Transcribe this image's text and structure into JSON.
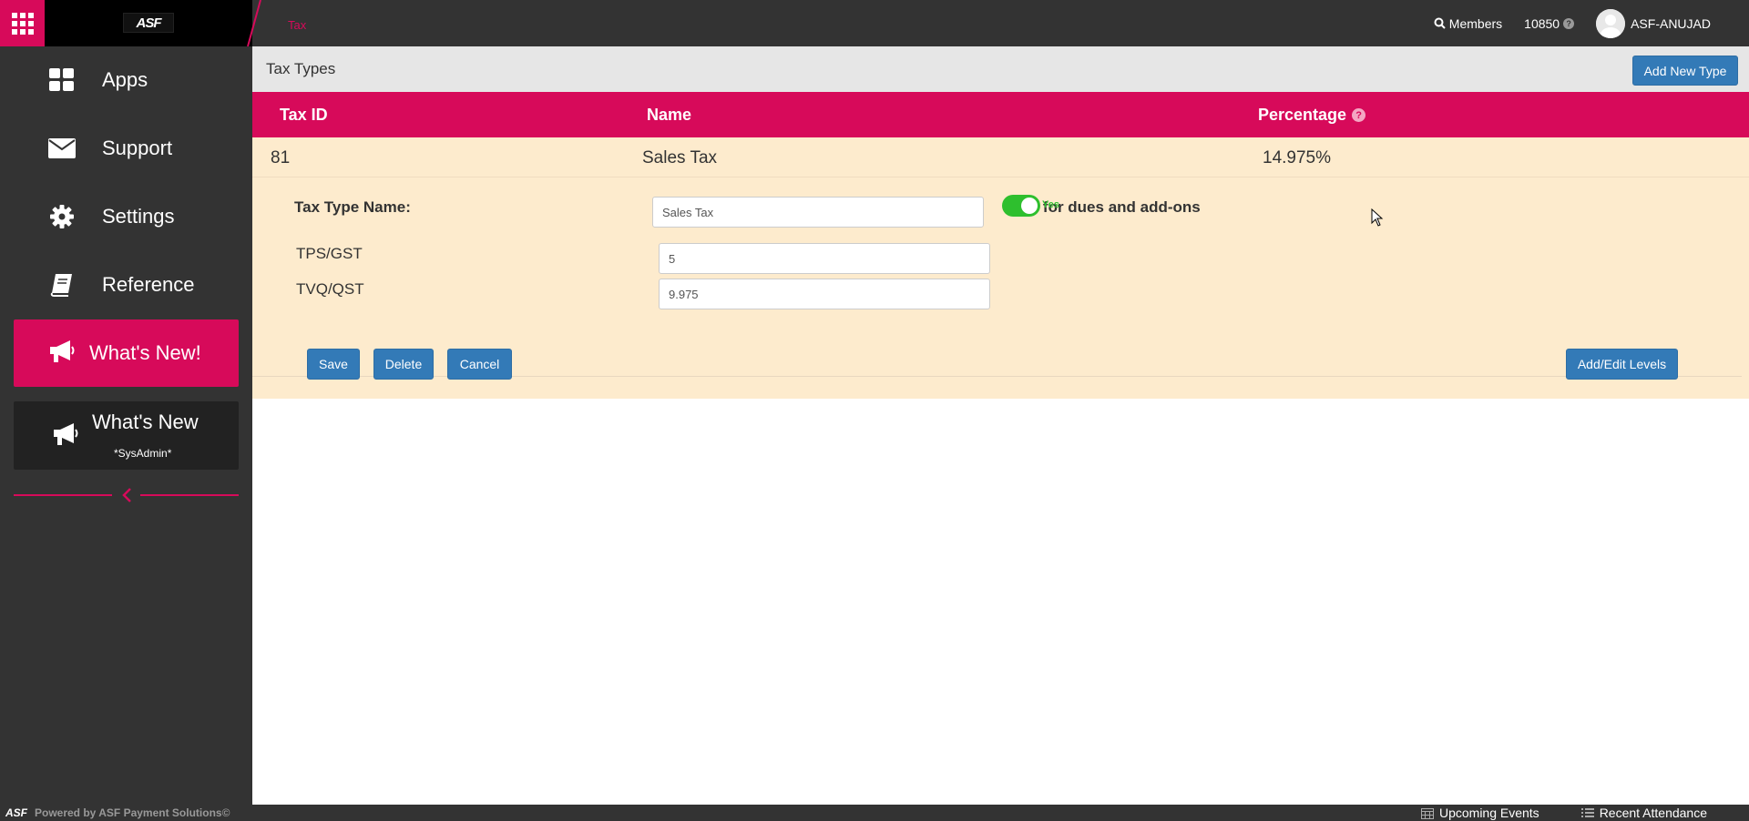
{
  "topbar": {
    "logo_text": "ASF",
    "breadcrumb": "Tax",
    "members_label": "Members",
    "credits": "10850",
    "help_glyph": "?",
    "username": "ASF-ANUJAD"
  },
  "sidebar": {
    "items": [
      {
        "label": "Apps",
        "icon": "apps-grid-icon"
      },
      {
        "label": "Support",
        "icon": "envelope-icon"
      },
      {
        "label": "Settings",
        "icon": "gear-icon"
      },
      {
        "label": "Reference",
        "icon": "book-icon"
      }
    ],
    "whats_new_highlight": "What's New!",
    "whats_new_sys": {
      "label": "What's New",
      "sub": "*SysAdmin*"
    },
    "accent_color": "#d70a5a"
  },
  "main": {
    "title": "Tax Types",
    "add_button": "Add New Type",
    "table": {
      "headers": [
        "Tax ID",
        "Name",
        "Percentage"
      ],
      "help_glyph": "?",
      "row": {
        "tax_id": "81",
        "name": "Sales Tax",
        "percentage": "14.975%"
      }
    },
    "form": {
      "tax_type_name_label": "Tax Type Name:",
      "tax_type_name_value": "Sales Tax",
      "use_for_label": "Use for dues and add-ons",
      "toggle_label": "Yes",
      "toggle_on": true,
      "levels": [
        {
          "label": "TPS/GST",
          "value": "5"
        },
        {
          "label": "TVQ/QST",
          "value": "9.975"
        }
      ]
    },
    "actions": {
      "save": "Save",
      "delete": "Delete",
      "cancel": "Cancel",
      "add_edit_levels": "Add/Edit Levels"
    }
  },
  "footer": {
    "logo_text": "ASF",
    "powered": "Powered by ASF Payment Solutions©",
    "upcoming_events": "Upcoming Events",
    "recent_attendance": "Recent Attendance"
  }
}
